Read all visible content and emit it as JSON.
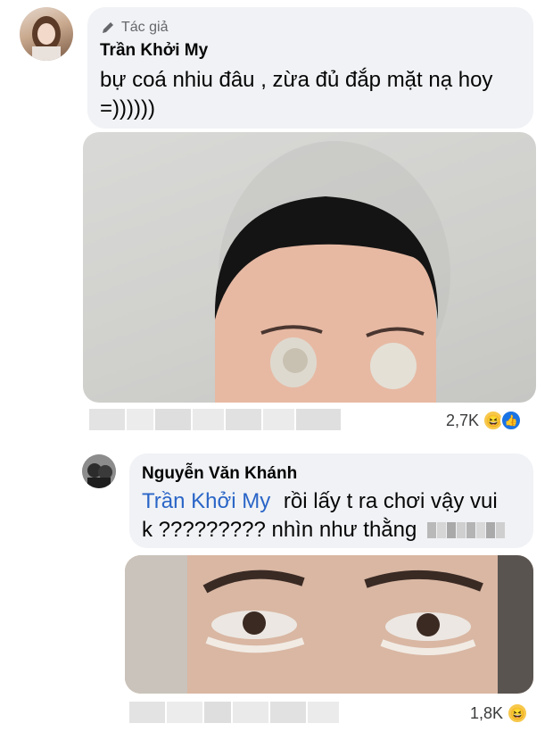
{
  "comments": [
    {
      "badge_label": "Tác giả",
      "author": "Trần Khởi My",
      "text_line1": "bự coá nhiu đâu , zừa đủ đắp mặt nạ hoy",
      "text_line2": "=))))))",
      "reaction_count": "2,7K",
      "reactions": [
        "haha-icon",
        "like-icon"
      ]
    },
    {
      "author": "Nguyễn Văn Khánh",
      "mention": "Trần Khởi My",
      "text_line1": "rồi lấy t ra chơi vậy vui",
      "text_line2": "k ????????? nhìn như thằng",
      "reaction_count": "1,8K",
      "reactions": [
        "haha-icon"
      ]
    }
  ],
  "colors": {
    "bubble": "#f0f2f5",
    "mention": "#2a65c7",
    "like": "#1b74e4"
  }
}
